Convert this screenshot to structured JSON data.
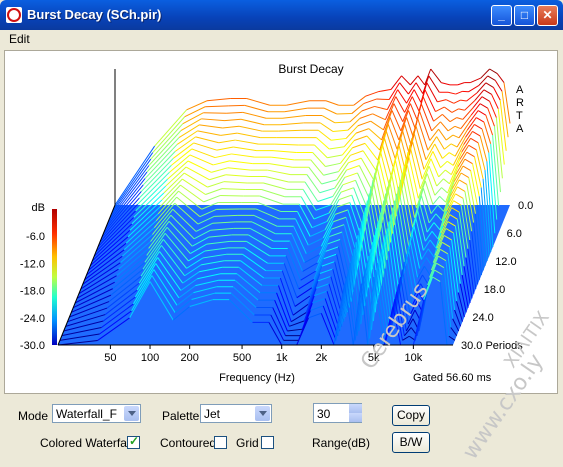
{
  "window": {
    "title": "Burst Decay  (SCh.pir)",
    "min_glyph": "_",
    "max_glyph": "□",
    "close_glyph": "✕"
  },
  "menu": {
    "edit": "Edit"
  },
  "chart_data": {
    "type": "waterfall",
    "title": "Burst Decay",
    "xlabel": "Frequency (Hz)",
    "ylabel": "dB",
    "zlabel": "Periods",
    "x_scale": "log",
    "x_ticks": [
      "50",
      "100",
      "200",
      "500",
      "1k",
      "2k",
      "5k",
      "10k"
    ],
    "y_ticks": [
      "-6.0",
      "-12.0",
      "-18.0",
      "-24.0",
      "-30.0"
    ],
    "z_ticks": [
      "0.0",
      "6.0",
      "12.0",
      "18.0",
      "24.0",
      "30.0 Periods"
    ],
    "ylim": [
      -30,
      0
    ],
    "zlim": [
      0,
      30
    ],
    "brand": "A R T A",
    "gated": "Gated 56.60 ms",
    "front_curve": {
      "freq": [
        20,
        40,
        70,
        100,
        150,
        200,
        300,
        400,
        600,
        800,
        1000,
        1300,
        1600,
        2000,
        2500,
        3000,
        3500,
        4000,
        4500,
        5000,
        6000,
        7000,
        8000,
        9000,
        10000,
        12000,
        14000,
        16000,
        18000,
        20000
      ],
      "db": [
        -30,
        -17,
        -9,
        -7,
        -6.5,
        -6.5,
        -8,
        -8,
        -7,
        -7,
        -8,
        -8,
        -6,
        -5,
        -4.5,
        -1.5,
        -3.5,
        -1.5,
        -3.5,
        0,
        -3,
        -3.5,
        -3.5,
        -3,
        -3,
        -2,
        0,
        -1,
        -3,
        -12
      ]
    },
    "decay_per_period": [
      1.3,
      0.4,
      0.5,
      0.3,
      0.6,
      0.5,
      0.4,
      0.4,
      0.6,
      0.6,
      0.9,
      0.8,
      0.6,
      0.6,
      1.2,
      0.5,
      1.0,
      0.5,
      0.9,
      0.5,
      1.1,
      0.6,
      1.0,
      0.9,
      1.0,
      0.6,
      0.5,
      0.5,
      0.9,
      2.0
    ],
    "palette": "Jet",
    "colors": {
      "high": "#a00000",
      "low": "#0050ff",
      "floor": "#1f6bff"
    }
  },
  "controls": {
    "mode_label": "Mode",
    "mode_value": "Waterfall_F",
    "palette_label": "Palette",
    "palette_value": "Jet",
    "range_value": "30",
    "range_label": "Range(dB)",
    "copy": "Copy",
    "bw": "B/W",
    "colored_waterfall": "Colored Waterfall",
    "contoured": "Contoured",
    "grid": "Grid"
  },
  "watermark": {
    "text1": "Cerebrus",
    "text2": "www.cxo.ly",
    "text3": "ΧΙΛΙΤΙΧ"
  }
}
